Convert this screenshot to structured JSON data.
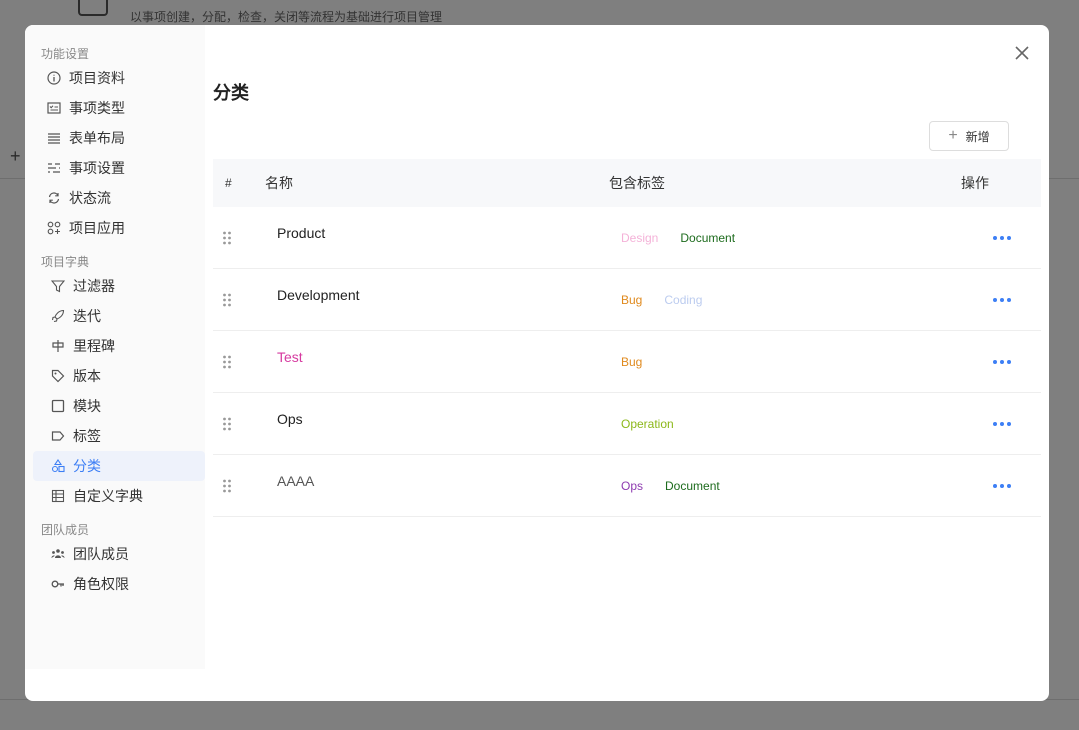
{
  "background": {
    "header_subtitle": "以事项创建，分配，检查，关闭等流程为基础进行项目管理"
  },
  "sidebar": {
    "groups": [
      {
        "title": "功能设置",
        "items": [
          {
            "label": "项目资料",
            "icon": "info-icon"
          },
          {
            "label": "事项类型",
            "icon": "checklist-icon"
          },
          {
            "label": "表单布局",
            "icon": "form-layout-icon"
          },
          {
            "label": "事项设置",
            "icon": "sliders-icon"
          },
          {
            "label": "状态流",
            "icon": "refresh-icon"
          },
          {
            "label": "项目应用",
            "icon": "apps-icon"
          }
        ]
      },
      {
        "title": "项目字典",
        "items": [
          {
            "label": "过滤器",
            "icon": "filter-icon"
          },
          {
            "label": "迭代",
            "icon": "rocket-icon"
          },
          {
            "label": "里程碑",
            "icon": "milestone-icon"
          },
          {
            "label": "版本",
            "icon": "tag-icon"
          },
          {
            "label": "模块",
            "icon": "square-icon"
          },
          {
            "label": "标签",
            "icon": "label-icon"
          },
          {
            "label": "分类",
            "icon": "shapes-icon",
            "active": true
          },
          {
            "label": "自定义字典",
            "icon": "table-icon"
          }
        ]
      },
      {
        "title": "团队成员",
        "items": [
          {
            "label": "团队成员",
            "icon": "team-icon"
          },
          {
            "label": "角色权限",
            "icon": "key-icon"
          }
        ]
      }
    ]
  },
  "main": {
    "title": "分类",
    "add_label": "新增",
    "columns": {
      "hash": "#",
      "name": "名称",
      "tags": "包含标签",
      "ops": "操作"
    },
    "rows": [
      {
        "name": "Product",
        "name_color": "#222222",
        "tags": [
          {
            "text": "Design",
            "color": "#f4b2d8"
          },
          {
            "text": "Document",
            "color": "#1d6b1d"
          }
        ]
      },
      {
        "name": "Development",
        "name_color": "#222222",
        "tags": [
          {
            "text": "Bug",
            "color": "#e08a1e"
          },
          {
            "text": "Coding",
            "color": "#bcccef"
          }
        ]
      },
      {
        "name": "Test",
        "name_color": "#d63ba0",
        "tags": [
          {
            "text": "Bug",
            "color": "#e08a1e"
          }
        ]
      },
      {
        "name": "Ops",
        "name_color": "#222222",
        "tags": [
          {
            "text": "Operation",
            "color": "#8cb81a"
          }
        ]
      },
      {
        "name": "AAAA",
        "name_color": "#555555",
        "tags": [
          {
            "text": "Ops",
            "color": "#8e3bb0"
          },
          {
            "text": "Document",
            "color": "#1d6b1d"
          }
        ]
      }
    ]
  },
  "colors": {
    "accent": "#3d7ff5",
    "active_bg": "#eef2fb",
    "sidebar_bg": "#fafafa"
  }
}
